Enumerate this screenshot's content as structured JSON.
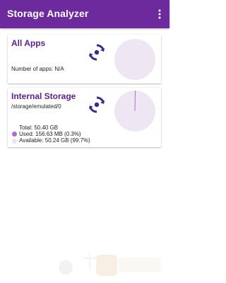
{
  "app": {
    "title": "Storage Analyzer",
    "menu_icon": "more-vert-icon"
  },
  "cards": {
    "all_apps": {
      "title": "All Apps",
      "num_apps_label": "Number of apps: N/A",
      "icon": "sync-icon"
    },
    "internal_storage": {
      "title": "Internal Storage",
      "path": "/storage/emulated/0",
      "icon": "sync-icon",
      "total": "Total: 50.40 GB",
      "used": "Used: 156.63 MB (0.3%)",
      "available": "Available: 50.24 GB (99.7%)",
      "used_fraction": 0.003
    }
  },
  "colors": {
    "app_bar": "#6c2a9c",
    "accent": "#5b1f90",
    "pie_fill": "#efe6f4",
    "used_dot": "#b06bd2",
    "available_dot": "#ece3f2"
  }
}
